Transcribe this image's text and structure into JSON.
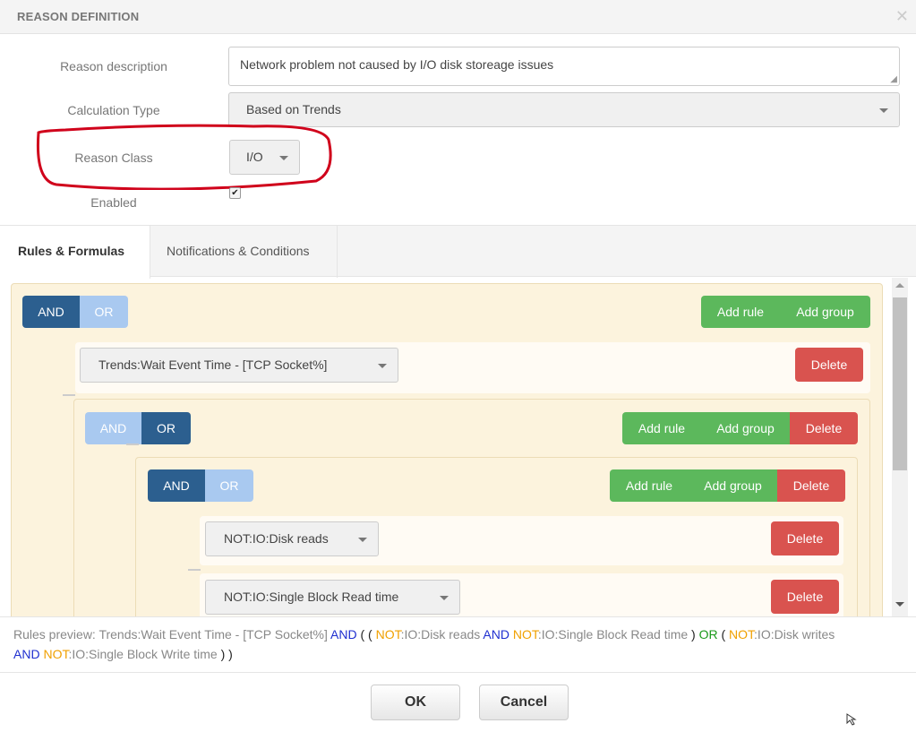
{
  "header": {
    "title": "REASON DEFINITION",
    "close": "✕"
  },
  "form": {
    "reason_description_label": "Reason description",
    "reason_description_value": "Network problem not caused by I/O disk storeage issues",
    "calculation_type_label": "Calculation Type",
    "calculation_type_value": "Based on Trends",
    "reason_class_label": "Reason Class",
    "reason_class_value": "I/O",
    "enabled_label": "Enabled",
    "enabled_check": "✔"
  },
  "tabs": [
    {
      "label": "Rules & Formulas"
    },
    {
      "label": "Notifications & Conditions"
    }
  ],
  "builder": {
    "and": "AND",
    "or": "OR",
    "add_rule": "Add rule",
    "add_group": "Add group",
    "delete": "Delete",
    "rule1": "Trends:Wait Event Time - [TCP Socket%]",
    "rule2": "NOT:IO:Disk reads",
    "rule3": "NOT:IO:Single Block Read time"
  },
  "preview": {
    "p1": "Rules preview: Trends:Wait Event Time - [TCP Socket%] ",
    "and": "AND",
    "open": " ( ( ",
    "not": "NOT",
    "p2": ":IO:Disk reads ",
    "p3": ":IO:Single Block Read time ",
    "close": ") ",
    "or": "OR",
    "open2": " ( ",
    "p4": ":IO:Disk writes",
    "p5": ":IO:Single Block Write time ",
    "end": ") )"
  },
  "footer": {
    "ok": "OK",
    "cancel": "Cancel"
  },
  "colors": {
    "annotation": "#d0021b",
    "green": "#5cb85c",
    "red": "#d9534f",
    "and_active": "#2c5f8f"
  }
}
